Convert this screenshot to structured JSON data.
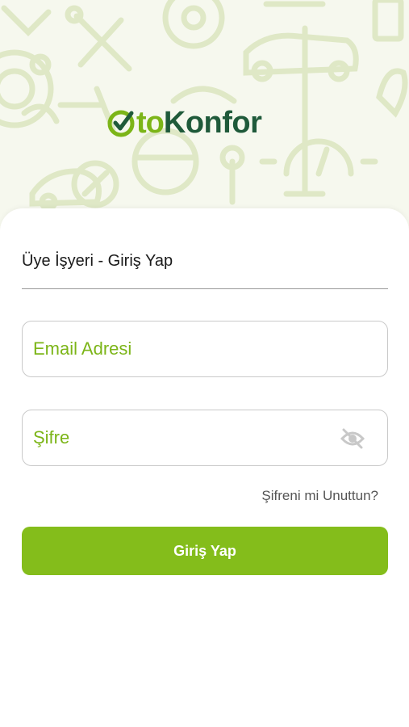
{
  "brand": {
    "name_part1": "to",
    "name_part2": "Konfor",
    "accent_color": "#7cb518",
    "dark_color": "#1f5a3a"
  },
  "background_icons": [
    "oil-can-icon",
    "wrench-screwdriver-icon",
    "tire-icon",
    "car-lift-icon",
    "battery-icon",
    "gauge-icon",
    "steering-wheel-icon",
    "gear-wrench-icon",
    "gear-shift-icon",
    "speedometer-icon",
    "car-icon"
  ],
  "login": {
    "title": "Üye İşyeri - Giriş Yap",
    "email_placeholder": "Email Adresi",
    "password_placeholder": "Şifre",
    "password_visibility_icon": "eye-off-icon",
    "forgot_label": "Şifreni mi Unuttun?",
    "submit_label": "Giriş Yap",
    "button_color": "#84bd1b"
  }
}
